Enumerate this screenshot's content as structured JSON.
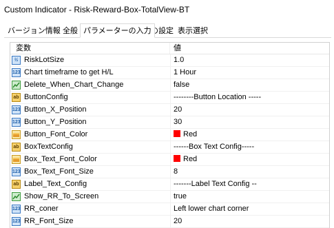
{
  "window": {
    "title": "Custom Indicator - Risk-Reward-Box-TotalView-BT"
  },
  "tabs": [
    {
      "label": "バージョン情報"
    },
    {
      "label": "全般"
    },
    {
      "label": "パラメーターの入力"
    },
    {
      "label": "色の設定"
    },
    {
      "label": "表示選択"
    }
  ],
  "active_tab": "パラメーターの入力",
  "table": {
    "headers": {
      "variable": "変数",
      "value": "値"
    },
    "rows": [
      {
        "name": "RiskLotSize",
        "value": "1.0",
        "icon": "double-type-icon"
      },
      {
        "name": "Chart timeframe to get H/L",
        "value": "1 Hour",
        "icon": "integer-type-icon"
      },
      {
        "name": "Delete_When_Chart_Change",
        "value": "false",
        "icon": "boolean-type-icon"
      },
      {
        "name": "ButtonConfig",
        "value": "--------Button Location -----",
        "icon": "string-type-icon"
      },
      {
        "name": "Button_X_Position",
        "value": "20",
        "icon": "integer-type-icon"
      },
      {
        "name": "Button_Y_Position",
        "value": "30",
        "icon": "integer-type-icon"
      },
      {
        "name": "Button_Font_Color",
        "value": "Red",
        "icon": "color-type-icon",
        "swatch": "#ff0000"
      },
      {
        "name": "BoxTextConfig",
        "value": "------Box Text Config-----",
        "icon": "string-type-icon"
      },
      {
        "name": "Box_Text_Font_Color",
        "value": "Red",
        "icon": "color-type-icon",
        "swatch": "#ff0000"
      },
      {
        "name": "Box_Text_Font_Size",
        "value": "8",
        "icon": "integer-type-icon"
      },
      {
        "name": "Label_Text_Config",
        "value": "-------Label Text Config --",
        "icon": "string-type-icon"
      },
      {
        "name": "Show_RR_To_Screen",
        "value": "true",
        "icon": "boolean-type-icon"
      },
      {
        "name": "RR_coner",
        "value": "Left lower chart corner",
        "icon": "integer-type-icon"
      },
      {
        "name": "RR_Font_Size",
        "value": "20",
        "icon": "integer-type-icon"
      }
    ]
  },
  "icon_labels": {
    "double": "½",
    "integer": "123",
    "string": "ab"
  },
  "colors": {
    "red_swatch": "#ff0000"
  }
}
